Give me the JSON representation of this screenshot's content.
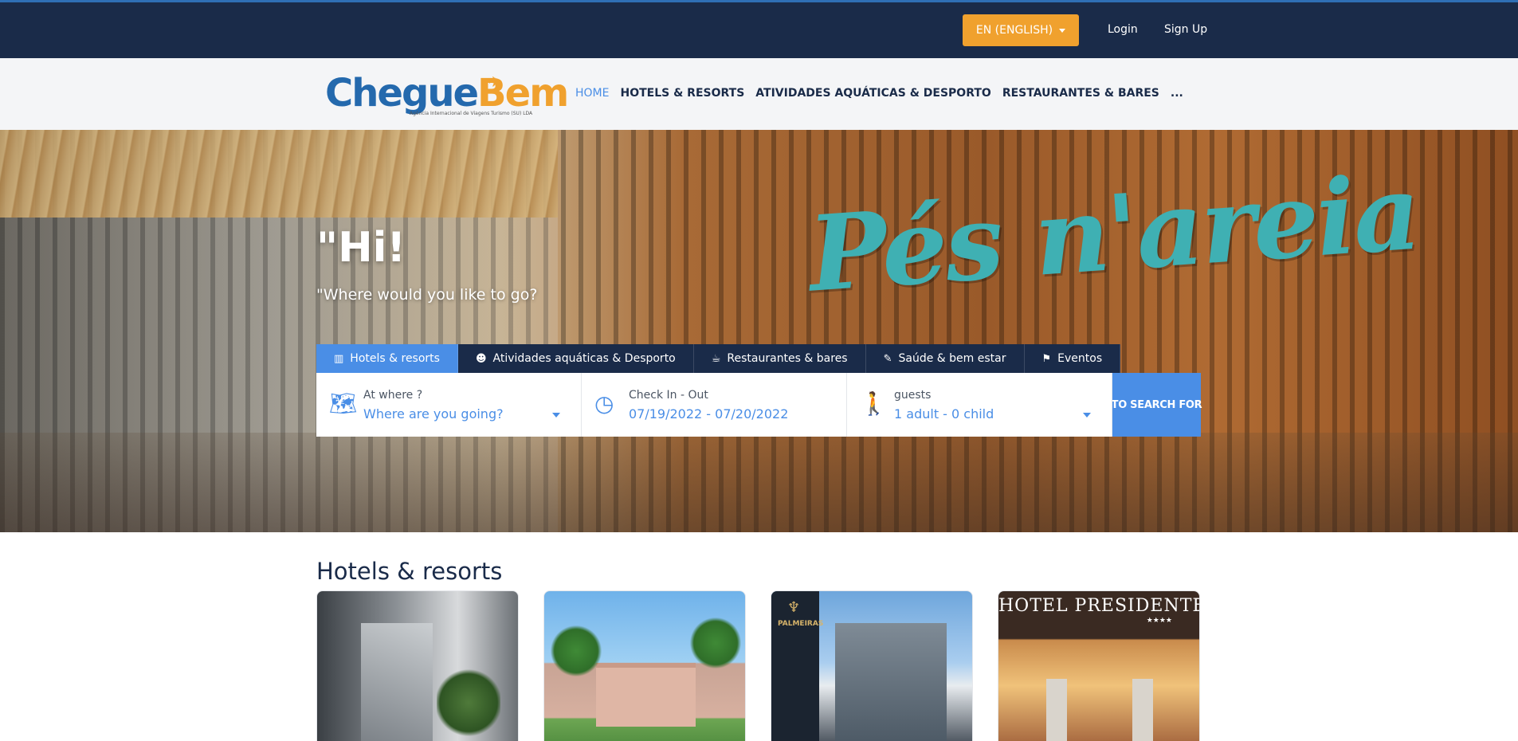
{
  "topbar": {
    "language_label": "EN (ENGLISH)",
    "login_label": "Login",
    "signup_label": "Sign Up"
  },
  "brand": {
    "logo_part1": "Chegue",
    "logo_part2": "Bem",
    "tagline": "Agência Internacional de Viagens Turismo (SU) LDA"
  },
  "nav": {
    "items": [
      {
        "label": "HOME",
        "active": true
      },
      {
        "label": "HOTELS & RESORTS"
      },
      {
        "label": "ATIVIDADES AQUÁTICAS & DESPORTO"
      },
      {
        "label": "RESTAURANTES & BARES"
      },
      {
        "label": "..."
      }
    ]
  },
  "hero": {
    "title": "\"Hi!",
    "subtitle": "\"Where would you like to go?",
    "sign_text": "Pés n'areia"
  },
  "tabs": [
    {
      "label": "Hotels & resorts",
      "icon": "building-icon",
      "active": true
    },
    {
      "label": "Atividades aquáticas & Desporto",
      "icon": "diver-icon"
    },
    {
      "label": "Restaurantes & bares",
      "icon": "drink-icon"
    },
    {
      "label": "Saúde & bem estar",
      "icon": "spa-icon"
    },
    {
      "label": "Eventos",
      "icon": "event-icon"
    }
  ],
  "search": {
    "where_label": "At where ?",
    "where_value": "Where are you going?",
    "dates_label": "Check In - Out",
    "dates_value": "07/19/2022 - 07/20/2022",
    "guests_label": "guests",
    "guests_value": "1 adult - 0 child",
    "button_label": "TO SEARCH FOR"
  },
  "hotels": {
    "section_title": "Hotels & resorts",
    "cards": [
      {
        "image": "modern hotel entrance with glass doors and plants"
      },
      {
        "image": "pink colonial building with palm trees"
      },
      {
        "image": "Palmeiras hotel tower and glass building"
      },
      {
        "image": "Hotel Presidente lobby entrance"
      }
    ],
    "card3_sign": "PALMEIRAS",
    "card4_sign": "HOTEL PRESIDENTE",
    "card4_stars": "★★★★"
  },
  "colors": {
    "navy": "#1a2b49",
    "accent_blue": "#4a8ee6",
    "accent_orange": "#f0a12e",
    "logo_blue": "#2469ad",
    "sign_teal": "#3fb0b3"
  }
}
